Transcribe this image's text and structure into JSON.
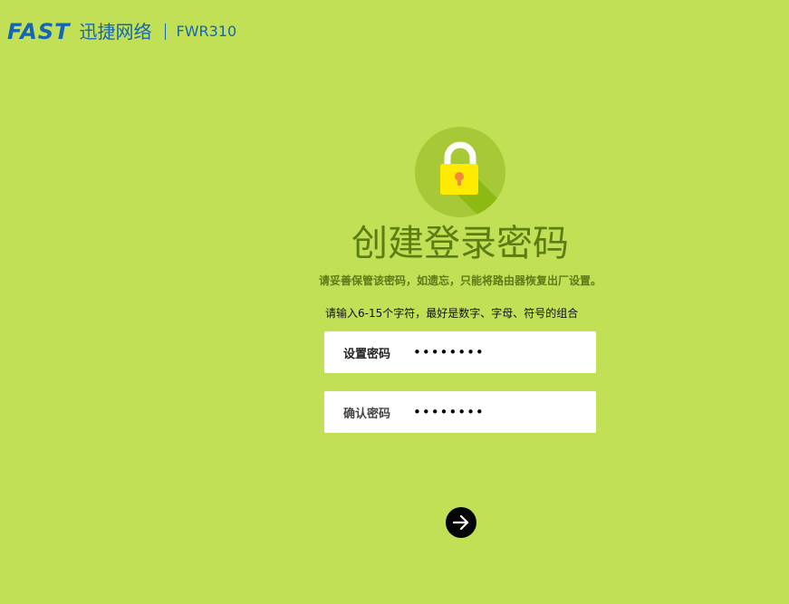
{
  "header": {
    "brand_logo": "FAST",
    "brand_name": "迅捷网络",
    "model": "FWR310"
  },
  "icons": {
    "lock": "lock-icon",
    "next": "arrow-right-icon"
  },
  "colors": {
    "background": "#c1e055",
    "brand_blue": "#1565b5",
    "title_green": "#5b7d14",
    "lock_yellow": "#ffeb00"
  },
  "main": {
    "title": "创建登录密码",
    "subtitle": "请妥善保管该密码，如遗忘，只能将路由器恢复出厂设置。",
    "hint": "请输入6-15个字符，最好是数字、字母、符号的组合"
  },
  "form": {
    "password_label": "设置密码",
    "password_value": "••••••••",
    "confirm_label": "确认密码",
    "confirm_value": "••••••••"
  }
}
